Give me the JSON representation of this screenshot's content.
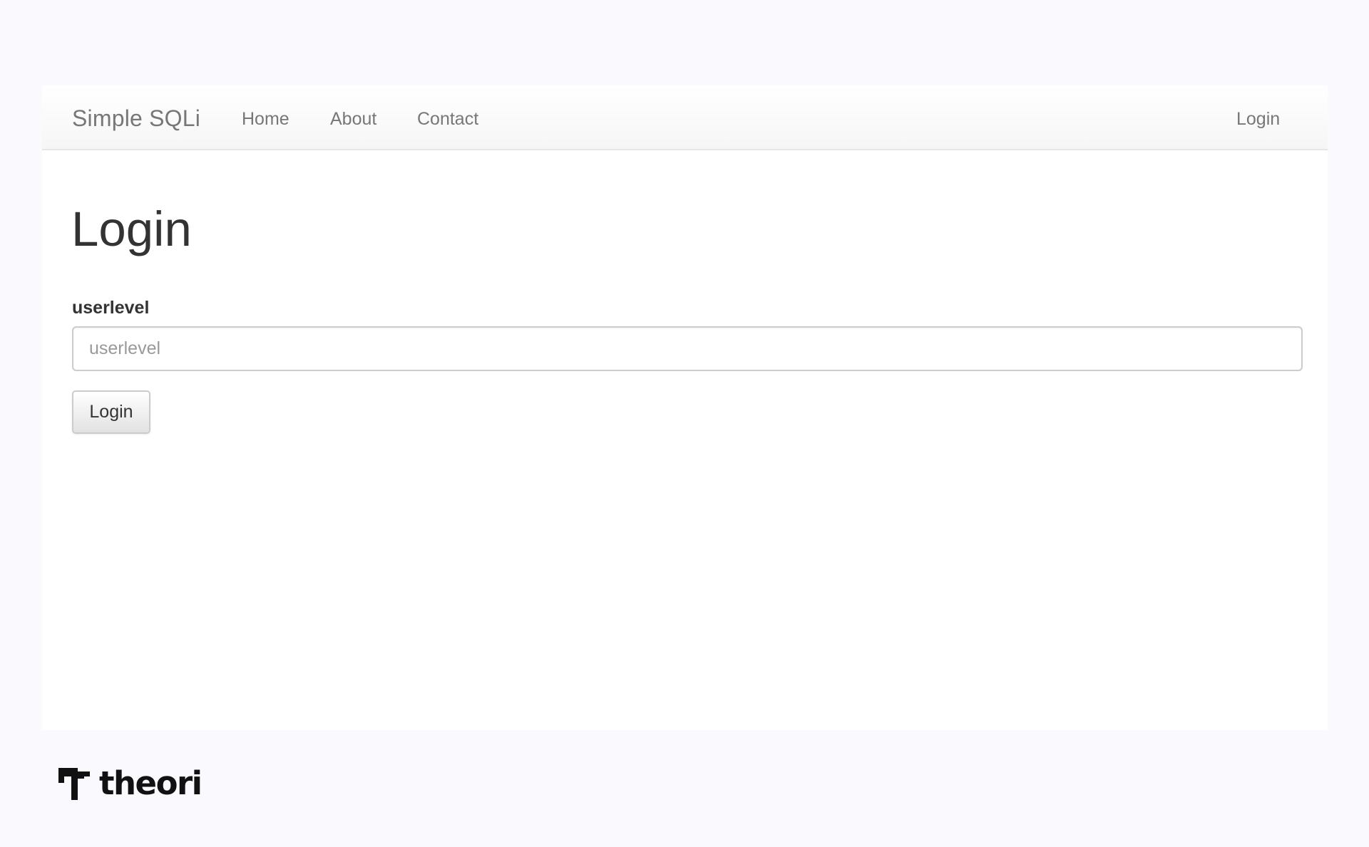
{
  "navbar": {
    "brand": "Simple SQLi",
    "links": [
      "Home",
      "About",
      "Contact"
    ],
    "login_link": "Login"
  },
  "main": {
    "title": "Login",
    "field_label": "userlevel",
    "field_placeholder": "userlevel",
    "field_value": "",
    "submit_label": "Login"
  },
  "footer": {
    "logo_text": "theori",
    "logo_icon": "theori-logo-icon"
  },
  "colors": {
    "page_background": "#f9f9fe",
    "card_background": "#ffffff",
    "navbar_text": "#777777",
    "heading_text": "#333333",
    "input_border": "#cccccc"
  }
}
